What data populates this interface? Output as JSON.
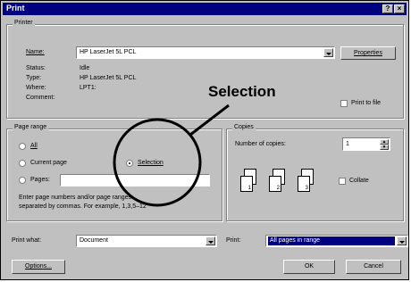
{
  "window": {
    "title": "Print"
  },
  "printer": {
    "legend": "Printer",
    "name_label": "Name:",
    "name_value": "HP LaserJet 5L PCL",
    "properties_label": "Properties",
    "status_label": "Status:",
    "status_value": "Idle",
    "type_label": "Type:",
    "type_value": "HP LaserJet 5L PCL",
    "where_label": "Where:",
    "where_value": "LPT1:",
    "comment_label": "Comment:",
    "print_to_file_label": "Print to file"
  },
  "page_range": {
    "legend": "Page range",
    "all_label": "All",
    "current_page_label": "Current page",
    "selection_label": "Selection",
    "pages_label": "Pages:",
    "help_text_line1": "Enter page numbers and/or page ranges",
    "help_text_line2": "separated by commas.  For example, 1,3,5–12"
  },
  "copies": {
    "legend": "Copies",
    "number_label": "Number of copies:",
    "number_value": "1",
    "collate_label": "Collate",
    "page_numbers": [
      "1",
      "2",
      "3"
    ]
  },
  "print_what": {
    "label": "Print what:",
    "value": "Document"
  },
  "print": {
    "label": "Print:",
    "value": "All pages in range"
  },
  "buttons": {
    "options": "Options...",
    "ok": "OK",
    "cancel": "Cancel"
  },
  "annotation": {
    "callout_text": "Selection"
  },
  "colors": {
    "titlebar": "#000080",
    "dialog_bg": "#c0c0c0",
    "highlight": "#000080"
  }
}
